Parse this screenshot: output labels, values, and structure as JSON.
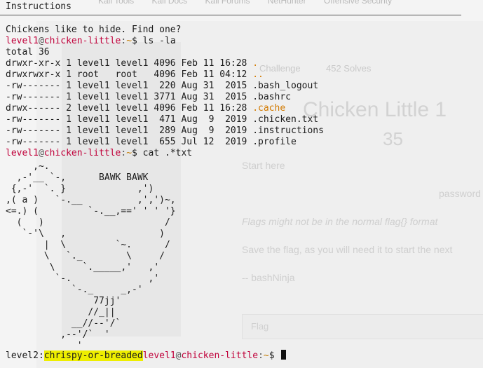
{
  "window_title": "Instructions",
  "background_page": {
    "bookmarks": [
      "Kali Tools",
      "Kali Docs",
      "Kali Forums",
      "NetHunter",
      "Offensive Security"
    ],
    "tab_challenge": "Challenge",
    "tab_solves": "452 Solves",
    "title": "Chicken Little 1",
    "points": "35",
    "start_here": "Start here",
    "password_text": "password",
    "flag_note": "Flags might not be in the normal flag{} format",
    "save_note": "Save the flag, as you will need it to start the next",
    "signature": "-- bashNinja",
    "flag_placeholder": "Flag"
  },
  "terminal": {
    "intro": "Chickens like to hide. Find one?",
    "prompt_user": "level1",
    "prompt_at": "@",
    "prompt_host": "chicken-little",
    "prompt_sep": ":",
    "prompt_path": "~",
    "prompt_dollar": "$",
    "cmd1": " ls -la",
    "total": "total 36",
    "listing": [
      {
        "pre": "drwxr-xr-x 1 level1 level1 4096 Feb 11 16:28 ",
        "name": ".",
        "type": "dir"
      },
      {
        "pre": "drwxrwxr-x 1 root   root   4096 Feb 11 04:12 ",
        "name": "..",
        "type": "dir"
      },
      {
        "pre": "-rw------- 1 level1 level1  220 Aug 31  2015 ",
        "name": ".bash_logout",
        "type": "file"
      },
      {
        "pre": "-rw------- 1 level1 level1 3771 Aug 31  2015 ",
        "name": ".bashrc",
        "type": "file"
      },
      {
        "pre": "drwx------ 2 level1 level1 4096 Feb 11 16:28 ",
        "name": ".cache",
        "type": "dir"
      },
      {
        "pre": "-rw------- 1 level1 level1  471 Aug  9  2019 ",
        "name": ".chicken.txt",
        "type": "file"
      },
      {
        "pre": "-rw------- 1 level1 level1  289 Aug  9  2019 ",
        "name": ".instructions",
        "type": "file"
      },
      {
        "pre": "-rw------- 1 level1 level1  655 Jul 12  2019 ",
        "name": ".profile",
        "type": "file"
      }
    ],
    "cmd2": " cat .*txt",
    "ascii_art": "     ,~.\n  ,-'__ `-,      BAWK BAWK\n {,-'  `. }             ,')\n,( a )   `-.__          ,',')~,\n<=.) (         `-.__,==' ' ' '}\n  (   )                      /\n   `-'\\   ,                 )\n       |  \\         `~.      /\n       \\   `._        \\     /\n        \\     `._____,'   ,'\n         `-.              ,'\n            `-._     _,-'\n                77jj'\n               //_||\n            __//--'/`\n          ,--'/`  '\n             '",
    "final_user_prefix": "level2",
    "final_colon": ":",
    "flag_highlight": "chrispy-or-breaded"
  }
}
